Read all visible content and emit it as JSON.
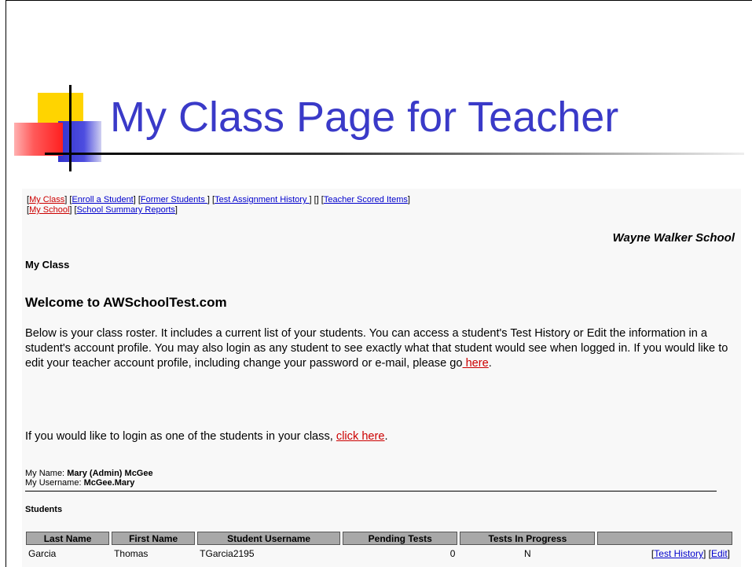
{
  "slide": {
    "title": "My Class Page for Teacher"
  },
  "nav": {
    "my_class": "My Class",
    "enroll": "Enroll a Student",
    "former": "Former Students ",
    "history": "Test Assignment History ",
    "empty": "",
    "scored": "Teacher Scored Items",
    "my_school": "My School",
    "summary": "School Summary Reports"
  },
  "school_name": "Wayne Walker School",
  "section_title": "My Class",
  "welcome": "Welcome to AWSchoolTest.com",
  "para1": {
    "text": "Below is your class roster. It includes a current list of your students. You can access a student's Test History or Edit the information in a student's account profile. You may also login as any student to see exactly what that student would see when logged in. If you would like to edit your teacher account profile, including change your password or e-mail, please go",
    "link": " here",
    "end": "."
  },
  "para2": {
    "text": "If you would like to login as one of the students in your class, ",
    "link": "click here",
    "end": "."
  },
  "account": {
    "name_label": "My Name: ",
    "name": "Mary (Admin) McGee",
    "username_label": "My Username: ",
    "username": "McGee.Mary"
  },
  "students_heading": "Students",
  "table": {
    "headers": [
      "Last Name",
      "First Name",
      "Student Username",
      "Pending Tests",
      "Tests In Progress",
      ""
    ],
    "rows": [
      {
        "last": "Garcia",
        "first": "Thomas",
        "username": "TGarcia2195",
        "pending": "0",
        "in_progress": "N",
        "history_link": "Test History",
        "edit_link": "Edit"
      }
    ]
  },
  "colors": {
    "title": "#3a3ac8",
    "link": "#0000cc",
    "link_current": "#cc0000",
    "header_bg": "#a8a8a8"
  }
}
